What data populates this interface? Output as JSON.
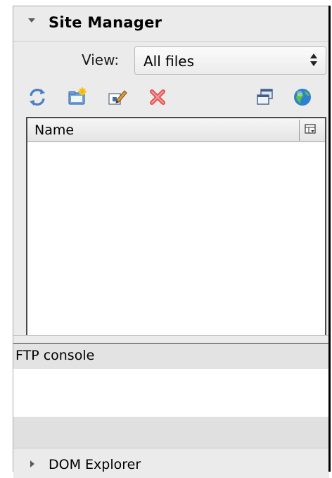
{
  "site_manager": {
    "title": "Site Manager",
    "expanded": true
  },
  "view": {
    "label": "View:",
    "selected": "All files"
  },
  "toolbar": {
    "icons": [
      "refresh-icon",
      "new-folder-icon",
      "rename-icon",
      "delete-icon",
      "sync-icon",
      "publish-icon"
    ]
  },
  "file_list": {
    "columns": [
      "Name"
    ],
    "rows": []
  },
  "ftp_console": {
    "title": "FTP console"
  },
  "dom_explorer": {
    "title": "DOM Explorer",
    "expanded": false
  },
  "colors": {
    "panel_bg": "#ebebeb",
    "delete_red": "#d63a3a",
    "globe_blue": "#2f7fd0"
  }
}
